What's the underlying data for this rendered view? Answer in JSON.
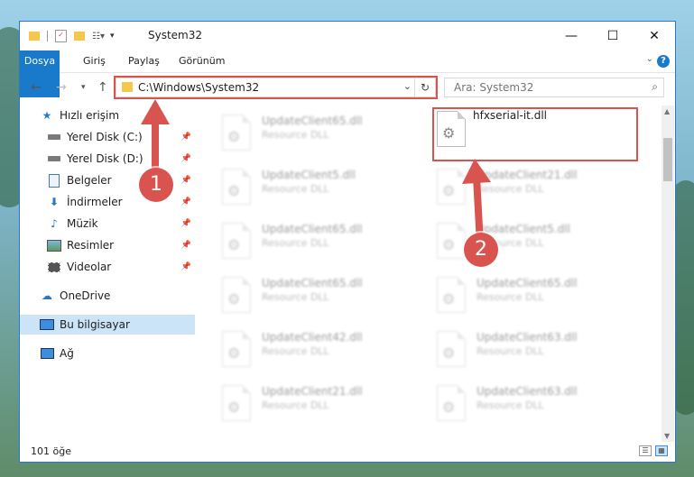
{
  "window": {
    "title": "System32",
    "controls": {
      "minimize": "—",
      "maximize": "☐",
      "close": "✕"
    }
  },
  "ribbon": {
    "tabs": [
      "Dosya",
      "Giriş",
      "Paylaş",
      "Görünüm"
    ],
    "help": "?"
  },
  "navbar": {
    "address": "C:\\Windows\\System32",
    "search_placeholder": "Ara: System32"
  },
  "sidebar": {
    "items": [
      {
        "label": "Hızlı erişim",
        "icon": "star-icon"
      },
      {
        "label": "Yerel Disk (C:)",
        "icon": "drive-icon"
      },
      {
        "label": "Yerel Disk (D:)",
        "icon": "drive-icon"
      },
      {
        "label": "Belgeler",
        "icon": "documents-icon"
      },
      {
        "label": "İndirmeler",
        "icon": "download-icon"
      },
      {
        "label": "Müzik",
        "icon": "music-icon"
      },
      {
        "label": "Resimler",
        "icon": "pictures-icon"
      },
      {
        "label": "Videolar",
        "icon": "videos-icon"
      },
      {
        "label": "OneDrive",
        "icon": "cloud-icon"
      },
      {
        "label": "Bu bilgisayar",
        "icon": "computer-icon"
      },
      {
        "label": "Ağ",
        "icon": "network-icon"
      }
    ]
  },
  "files": {
    "left": [
      {
        "name": "UpdateClient65.dll",
        "type": "Resource DLL"
      },
      {
        "name": "UpdateClient5.dll",
        "type": "Resource DLL"
      },
      {
        "name": "UpdateClient65.dll",
        "type": "Resource DLL"
      },
      {
        "name": "UpdateClient65.dll",
        "type": "Resource DLL"
      },
      {
        "name": "UpdateClient42.dll",
        "type": "Resource DLL"
      },
      {
        "name": "UpdateClient21.dll",
        "type": "Resource DLL"
      }
    ],
    "right": [
      {
        "name": "hfxserial-it.dll",
        "type": ""
      },
      {
        "name": "UpdateClient21.dll",
        "type": "Resource DLL"
      },
      {
        "name": "UpdateClient5.dll",
        "type": "Resource DLL"
      },
      {
        "name": "UpdateClient65.dll",
        "type": "Resource DLL"
      },
      {
        "name": "UpdateClient63.dll",
        "type": "Resource DLL"
      },
      {
        "name": "UpdateClient63.dll",
        "type": "Resource DLL"
      }
    ]
  },
  "status": {
    "count": "101 öğe"
  },
  "annotations": {
    "one": "1",
    "two": "2"
  },
  "colors": {
    "accent": "#1979ca",
    "highlight": "#d9534f"
  }
}
